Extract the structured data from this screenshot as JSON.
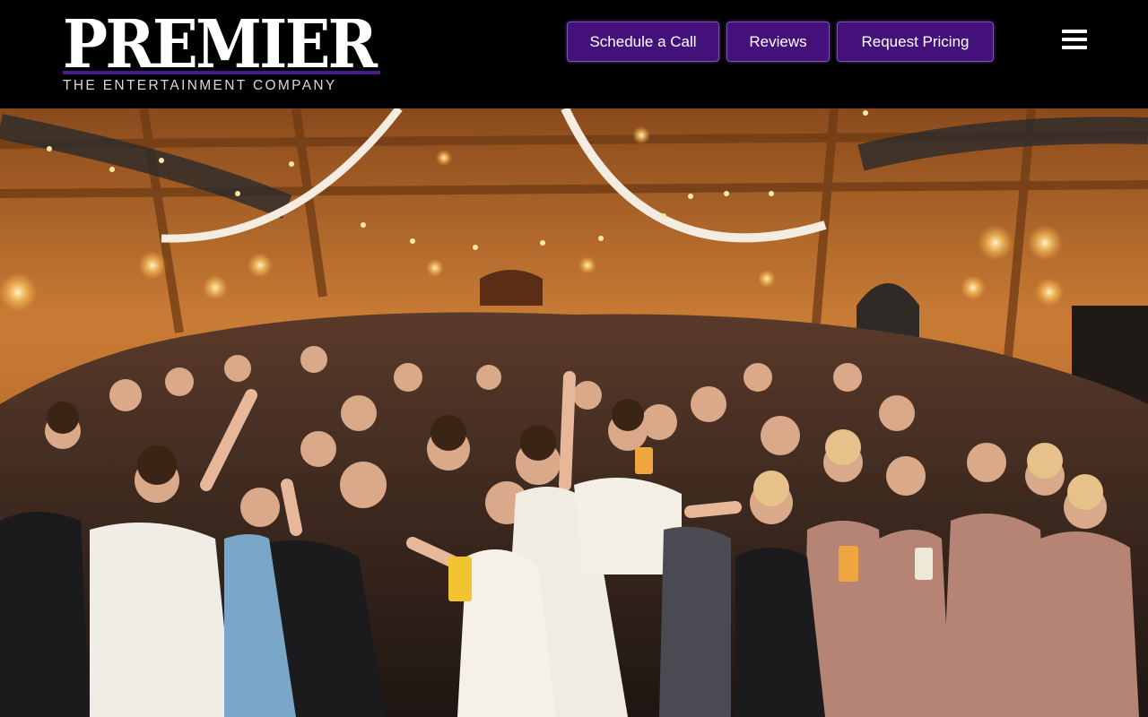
{
  "brand": {
    "name": "PREMIER",
    "tagline": "THE ENTERTAINMENT COMPANY"
  },
  "nav": {
    "buttons": [
      {
        "label": "Schedule a Call"
      },
      {
        "label": "Reviews"
      },
      {
        "label": "Request Pricing"
      }
    ],
    "menu_icon": "hamburger-menu-icon"
  },
  "colors": {
    "header_bg": "#000000",
    "button_bg": "#44117a",
    "logo_rule": "#4b1a8a",
    "wood": "#c77a33"
  },
  "hero": {
    "image": "wedding-reception-crowd-photo"
  }
}
